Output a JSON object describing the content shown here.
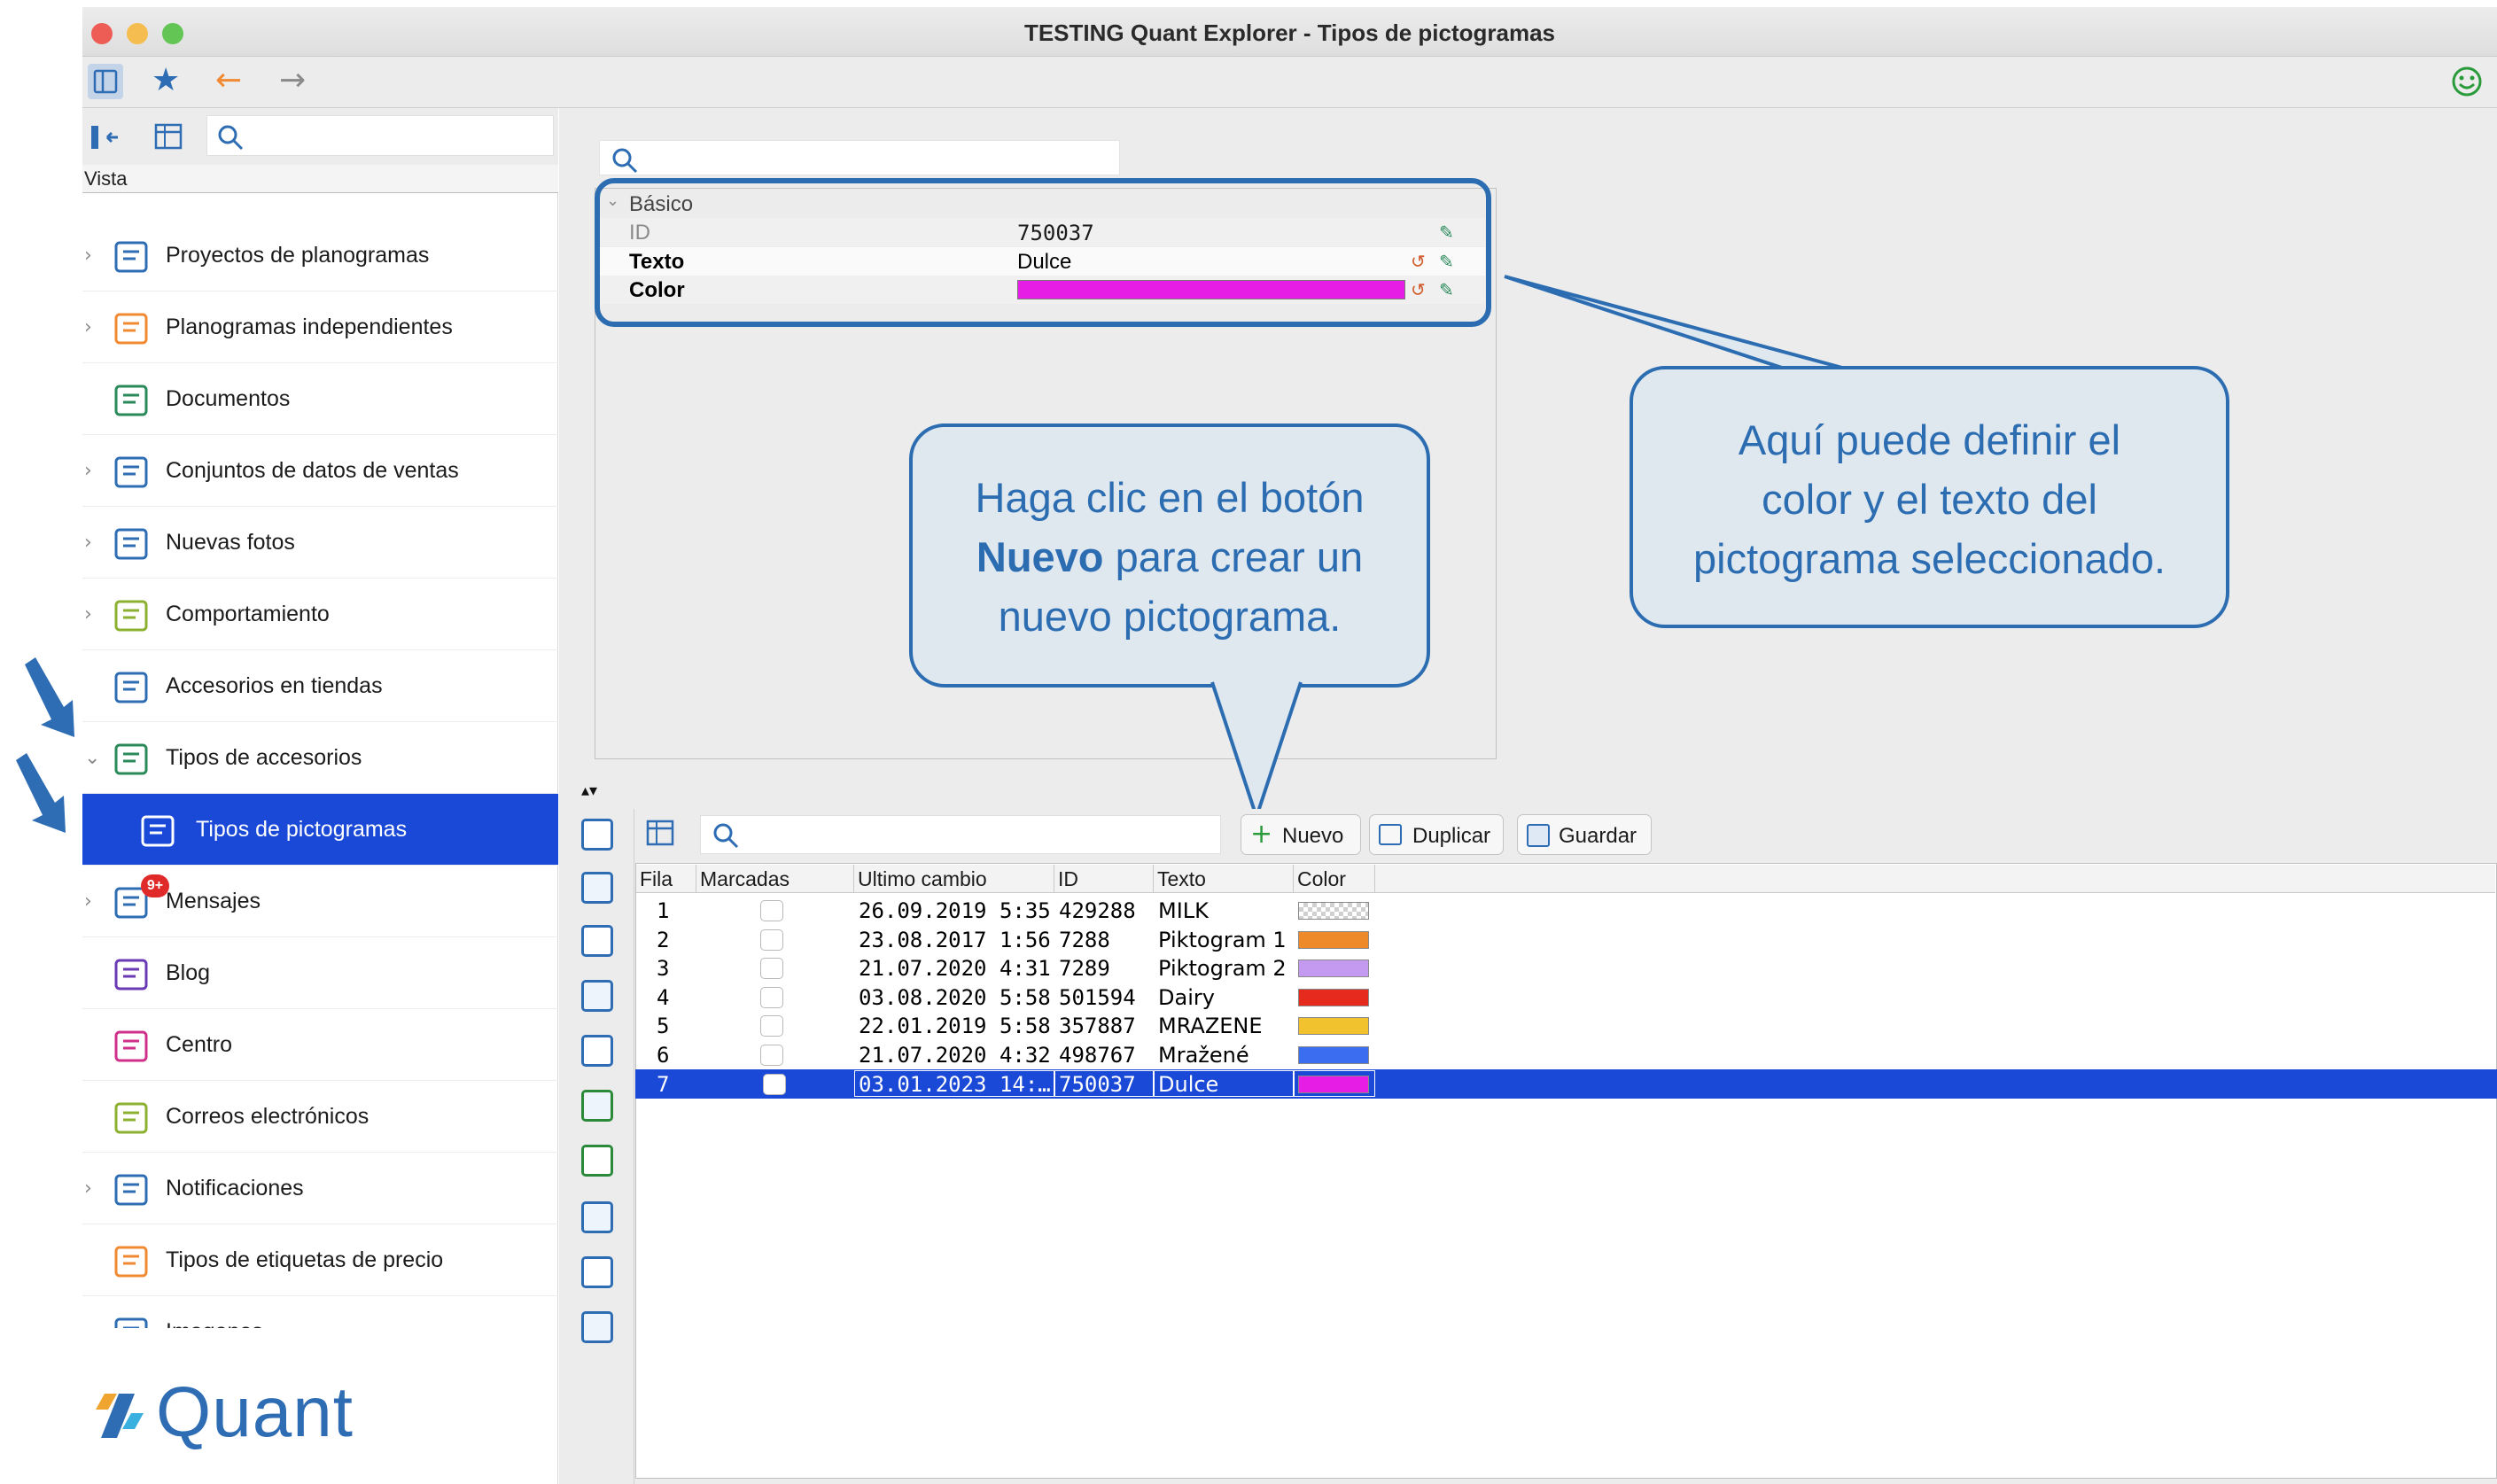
{
  "window": {
    "title": "TESTING Quant Explorer - Tipos de pictogramas",
    "traffic_lights": [
      "#ee5c56",
      "#f5bd4f",
      "#62c554"
    ]
  },
  "toolbar": {
    "icons": [
      "sidebar-toggle-icon",
      "favorites-star-icon",
      "back-arrow-icon",
      "forward-arrow-icon",
      "smiley-icon"
    ]
  },
  "sidebar": {
    "vista_label": "Vista",
    "items": [
      {
        "label": "Proyectos de planogramas",
        "chevron": true,
        "icon": "planogram-projects-icon"
      },
      {
        "label": "Planogramas independientes",
        "chevron": true,
        "icon": "independent-planograms-icon"
      },
      {
        "label": "Documentos",
        "chevron": false,
        "icon": "documents-icon"
      },
      {
        "label": "Conjuntos de datos de ventas",
        "chevron": true,
        "icon": "sales-data-icon"
      },
      {
        "label": "Nuevas fotos",
        "chevron": true,
        "icon": "camera-icon"
      },
      {
        "label": "Comportamiento",
        "chevron": true,
        "icon": "behavior-icon"
      },
      {
        "label": "Accesorios en tiendas",
        "chevron": false,
        "icon": "store-accessories-icon"
      },
      {
        "label": "Tipos de accesorios",
        "chevron": true,
        "icon": "accessory-types-icon"
      },
      {
        "label": "Tipos de pictogramas",
        "chevron": false,
        "icon": "pictogram-types-icon"
      },
      {
        "label": "Mensajes",
        "chevron": true,
        "icon": "messages-icon",
        "badge": "9+"
      },
      {
        "label": "Blog",
        "chevron": false,
        "icon": "blog-icon"
      },
      {
        "label": "Centro",
        "chevron": false,
        "icon": "center-icon"
      },
      {
        "label": "Correos electrónicos",
        "chevron": false,
        "icon": "email-icon"
      },
      {
        "label": "Notificaciones",
        "chevron": true,
        "icon": "notifications-icon"
      },
      {
        "label": "Tipos de etiquetas de precio",
        "chevron": false,
        "icon": "price-labels-icon"
      },
      {
        "label": "Imagenes",
        "chevron": false,
        "icon": "images-icon"
      }
    ],
    "logo_text": "Quant"
  },
  "properties": {
    "section": "Básico",
    "rows": [
      {
        "key": "ID",
        "value": "750037"
      },
      {
        "key": "Texto",
        "value": "Dulce"
      },
      {
        "key": "Color",
        "value": "",
        "color": "#e61de4"
      }
    ]
  },
  "callouts": {
    "nuevo_pre": "Haga clic en el botón",
    "nuevo_bold": "Nuevo",
    "nuevo_post1": " para crear un",
    "nuevo_post2": "nuevo pictograma.",
    "define_line1": "Aquí puede definir el",
    "define_line2": "color y el texto del",
    "define_line3": "pictograma seleccionado."
  },
  "table_toolbar": {
    "nuevo": "Nuevo",
    "duplicar": "Duplicar",
    "guardar": "Guardar"
  },
  "table": {
    "columns": [
      "Fila",
      "Marcadas",
      "Ultimo cambio",
      "ID",
      "Texto",
      "Color"
    ],
    "rows": [
      {
        "fila": "1",
        "cambio": "26.09.2019 5:35",
        "id": "429288",
        "texto": "MILK",
        "color": "checker"
      },
      {
        "fila": "2",
        "cambio": "23.08.2017 1:56",
        "id": "7288",
        "texto": "Piktogram 1",
        "color": "#ee8a2a"
      },
      {
        "fila": "3",
        "cambio": "21.07.2020 4:31",
        "id": "7289",
        "texto": "Piktogram 2",
        "color": "#c39af0"
      },
      {
        "fila": "4",
        "cambio": "03.08.2020 5:58",
        "id": "501594",
        "texto": "Dairy",
        "color": "#e62a1e"
      },
      {
        "fila": "5",
        "cambio": "22.01.2019 5:58",
        "id": "357887",
        "texto": "MRAZENE",
        "color": "#f2c12e"
      },
      {
        "fila": "6",
        "cambio": "21.07.2020 4:32",
        "id": "498767",
        "texto": "Mražené",
        "color": "#3a6df0"
      },
      {
        "fila": "7",
        "cambio": "03.01.2023 14:…",
        "id": "750037",
        "texto": "Dulce",
        "color": "#e61de4"
      }
    ],
    "selected_row": 7
  },
  "colors": {
    "accent": "#1a49d8",
    "callout": "#2c6db2",
    "bubble_fill": "#dfe7ef"
  }
}
